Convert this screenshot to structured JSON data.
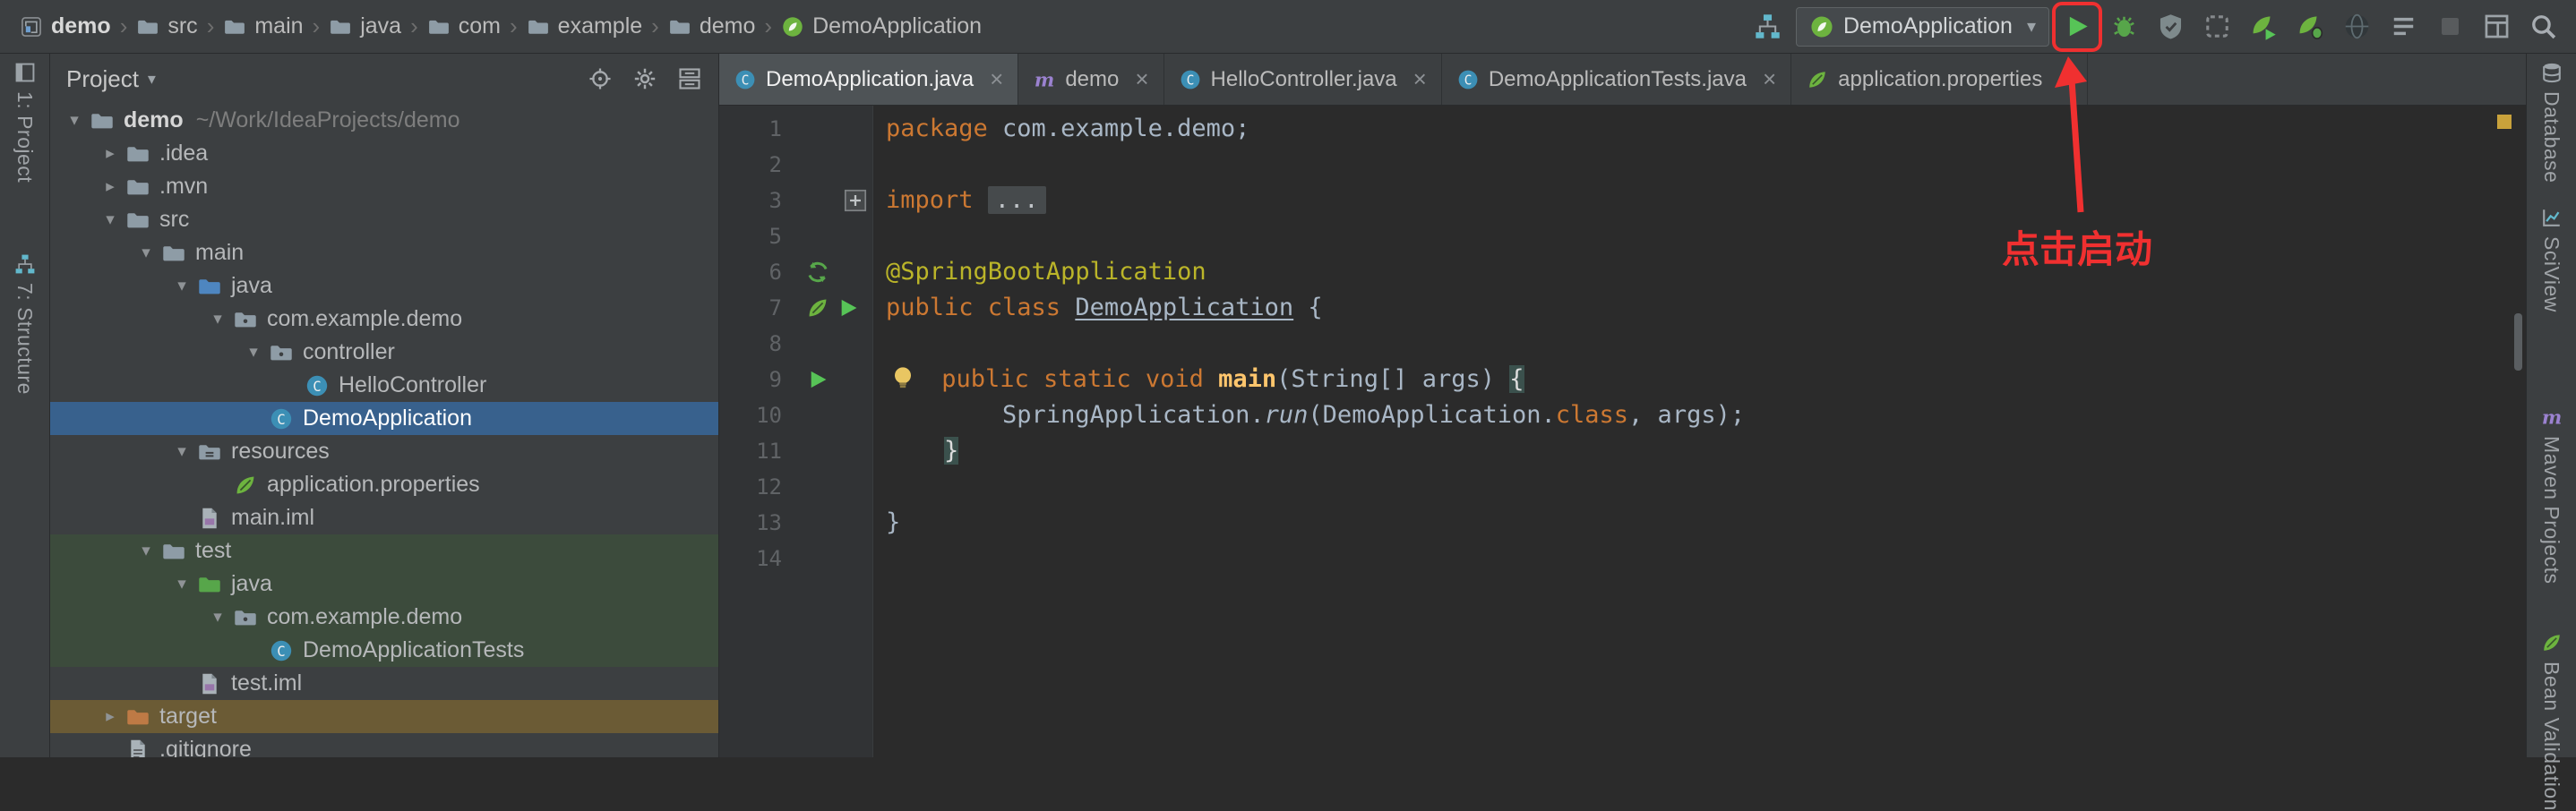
{
  "annotation": {
    "text": "点击启动",
    "color": "#F03030"
  },
  "breadcrumbs": {
    "items": [
      {
        "label": "demo",
        "icon": "project"
      },
      {
        "label": "src",
        "icon": "folder"
      },
      {
        "label": "main",
        "icon": "folder"
      },
      {
        "label": "java",
        "icon": "folder"
      },
      {
        "label": "com",
        "icon": "folder"
      },
      {
        "label": "example",
        "icon": "folder"
      },
      {
        "label": "demo",
        "icon": "folder"
      },
      {
        "label": "DemoApplication",
        "icon": "spring-boot"
      }
    ]
  },
  "toolbar": {
    "left_icon": "structure",
    "run_config": {
      "label": "DemoApplication",
      "icon": "spring-boot"
    },
    "buttons": [
      {
        "name": "run",
        "icon": "play",
        "highlighted": true
      },
      {
        "name": "debug",
        "icon": "bug"
      },
      {
        "name": "run-with-coverage",
        "icon": "coverage"
      },
      {
        "name": "profiler",
        "icon": "profiler"
      },
      {
        "name": "spring-run",
        "icon": "leaf-run"
      },
      {
        "name": "spring-debug",
        "icon": "leaf-debug"
      },
      {
        "name": "globe",
        "icon": "globe"
      },
      {
        "name": "console",
        "icon": "console"
      },
      {
        "name": "stop",
        "icon": "stop",
        "disabled": true
      },
      {
        "name": "window-layout",
        "icon": "window"
      },
      {
        "name": "search-everywhere",
        "icon": "search"
      }
    ]
  },
  "left_stripe": {
    "items": [
      {
        "label": "1: Project",
        "icon": "project-tool"
      },
      {
        "label": "7: Structure",
        "icon": "structure"
      }
    ]
  },
  "right_stripe": {
    "items": [
      {
        "label": "Database",
        "icon": "database"
      },
      {
        "label": "SciView",
        "icon": "sciview"
      },
      {
        "label": "Maven Projects",
        "icon": "maven"
      },
      {
        "label": "Bean Validation",
        "icon": "leaf"
      }
    ]
  },
  "project_panel": {
    "title": "Project",
    "actions": [
      "locate",
      "settings",
      "collapse-all"
    ],
    "tree": [
      {
        "label": "demo",
        "hint": "~/Work/IdeaProjects/demo",
        "icon": "folder",
        "depth": 0,
        "chevron": "down",
        "bold": true
      },
      {
        "label": ".idea",
        "icon": "folder",
        "depth": 1,
        "chevron": "right"
      },
      {
        "label": ".mvn",
        "icon": "folder",
        "depth": 1,
        "chevron": "right"
      },
      {
        "label": "src",
        "icon": "folder",
        "depth": 1,
        "chevron": "down"
      },
      {
        "label": "main",
        "icon": "folder",
        "depth": 2,
        "chevron": "down"
      },
      {
        "label": "java",
        "icon": "src-folder",
        "depth": 3,
        "chevron": "down"
      },
      {
        "label": "com.example.demo",
        "icon": "package",
        "depth": 4,
        "chevron": "down"
      },
      {
        "label": "controller",
        "icon": "package",
        "depth": 5,
        "chevron": "down"
      },
      {
        "label": "HelloController",
        "icon": "class",
        "depth": 6,
        "chevron": ""
      },
      {
        "label": "DemoApplication",
        "icon": "class",
        "depth": 5,
        "chevron": "",
        "selected": true
      },
      {
        "label": "resources",
        "icon": "res-folder",
        "depth": 3,
        "chevron": "down"
      },
      {
        "label": "application.properties",
        "icon": "spring-config",
        "depth": 4,
        "chevron": ""
      },
      {
        "label": "main.iml",
        "icon": "iml",
        "depth": 3,
        "chevron": ""
      },
      {
        "label": "test",
        "icon": "folder",
        "depth": 2,
        "chevron": "down",
        "scope": "test"
      },
      {
        "label": "java",
        "icon": "test-folder",
        "depth": 3,
        "chevron": "down",
        "scope": "test"
      },
      {
        "label": "com.example.demo",
        "icon": "package",
        "depth": 4,
        "chevron": "down",
        "scope": "test"
      },
      {
        "label": "DemoApplicationTests",
        "icon": "class",
        "depth": 5,
        "chevron": "",
        "scope": "test"
      },
      {
        "label": "test.iml",
        "icon": "iml",
        "depth": 3,
        "chevron": ""
      },
      {
        "label": "target",
        "icon": "excluded-folder",
        "depth": 1,
        "chevron": "right",
        "scope": "excluded"
      },
      {
        "label": ".gitignore",
        "icon": "text-file",
        "depth": 1,
        "chevron": ""
      }
    ]
  },
  "editor": {
    "tabs": [
      {
        "label": "DemoApplication.java",
        "icon": "class",
        "active": true
      },
      {
        "label": "demo",
        "icon": "maven"
      },
      {
        "label": "HelloController.java",
        "icon": "class"
      },
      {
        "label": "DemoApplicationTests.java",
        "icon": "class"
      },
      {
        "label": "application.properties",
        "icon": "spring-config"
      }
    ],
    "lines": [
      {
        "num": "1",
        "icons": [],
        "tokens": [
          {
            "c": "kw",
            "t": "package "
          },
          {
            "c": "pl",
            "t": "com.example.demo;"
          }
        ]
      },
      {
        "num": "2",
        "icons": [],
        "tokens": []
      },
      {
        "num": "3",
        "icons": [
          "fold-plus"
        ],
        "tokens": [
          {
            "c": "kw",
            "t": "import "
          },
          {
            "c": "fold",
            "t": "..."
          }
        ]
      },
      {
        "num": "5",
        "icons": [],
        "tokens": []
      },
      {
        "num": "6",
        "icons": [
          "bean"
        ],
        "tokens": [
          {
            "c": "ann",
            "t": "@SpringBootApplication"
          }
        ]
      },
      {
        "num": "7",
        "icons": [
          "spring-leaf",
          "play"
        ],
        "tokens": [
          {
            "c": "kw",
            "t": "public class "
          },
          {
            "c": "clsu",
            "t": "DemoApplication"
          },
          {
            "c": "pl",
            "t": " {"
          }
        ]
      },
      {
        "num": "8",
        "icons": [],
        "tokens": []
      },
      {
        "num": "9",
        "icons": [
          "play"
        ],
        "tokens": [
          {
            "c": "bulb",
            "t": ""
          },
          {
            "c": "pl",
            "t": " "
          },
          {
            "c": "kw",
            "t": "public static void "
          },
          {
            "c": "meth",
            "t": "main"
          },
          {
            "c": "pl",
            "t": "(String[] args) "
          },
          {
            "c": "brace",
            "t": "{"
          }
        ]
      },
      {
        "num": "10",
        "icons": [],
        "tokens": [
          {
            "c": "pl",
            "t": "        SpringApplication."
          },
          {
            "c": "smeth",
            "t": "run"
          },
          {
            "c": "pl",
            "t": "(DemoApplication."
          },
          {
            "c": "kw",
            "t": "class"
          },
          {
            "c": "pl",
            "t": ", args);"
          }
        ]
      },
      {
        "num": "11",
        "icons": [],
        "tokens": [
          {
            "c": "pl",
            "t": "    "
          },
          {
            "c": "brace",
            "t": "}"
          }
        ]
      },
      {
        "num": "12",
        "icons": [],
        "tokens": []
      },
      {
        "num": "13",
        "icons": [],
        "tokens": [
          {
            "c": "pl",
            "t": "}"
          }
        ]
      },
      {
        "num": "14",
        "icons": [],
        "tokens": []
      }
    ]
  }
}
